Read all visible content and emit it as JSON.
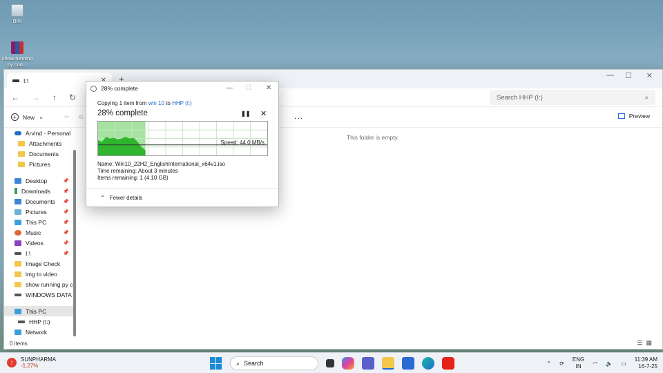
{
  "desktop": {
    "icons": [
      {
        "label": "BIN"
      },
      {
        "label": "show running py cod..."
      }
    ]
  },
  "explorer": {
    "tab_title": "I:\\",
    "search_placeholder": "Search HHP (I:)",
    "new_label": "New",
    "more_label": "...",
    "preview_label": "Preview",
    "empty_message": "This folder is empty.",
    "status": "0 items",
    "sidebar": {
      "group1": [
        "Arvind - Personal",
        "Attachments",
        "Documents",
        "Pictures"
      ],
      "quick": [
        "Desktop",
        "Downloads",
        "Documents",
        "Pictures",
        "This PC",
        "Music",
        "Videos",
        "I:\\",
        "Image Check",
        "img to video",
        "show running py cod",
        "WINDOWS DATA (C:"
      ],
      "bottom": [
        "This PC",
        "HHP (I:)",
        "Network"
      ]
    }
  },
  "dialog": {
    "title": "28% complete",
    "copy_prefix": "Copying 1 item from",
    "source": "win 10",
    "to_word": "to",
    "dest": "HHP (I:)",
    "heading": "28% complete",
    "progress_percent": 28,
    "speed": "Speed: 44.0 MB/s",
    "name": "Name: Win10_22H2_EnglishInternational_x64v1.iso",
    "time_remaining": "Time remaining: About 3 minutes",
    "items_remaining": "Items remaining: 1 (4.10 GB)",
    "fewer_details": "Fewer details"
  },
  "taskbar": {
    "stock_name": "SUNPHARMA",
    "stock_change": "-1.27%",
    "search_label": "Search",
    "lang_top": "ENG",
    "lang_bottom": "IN",
    "time": "11:39 AM",
    "date": "16-7-25"
  }
}
